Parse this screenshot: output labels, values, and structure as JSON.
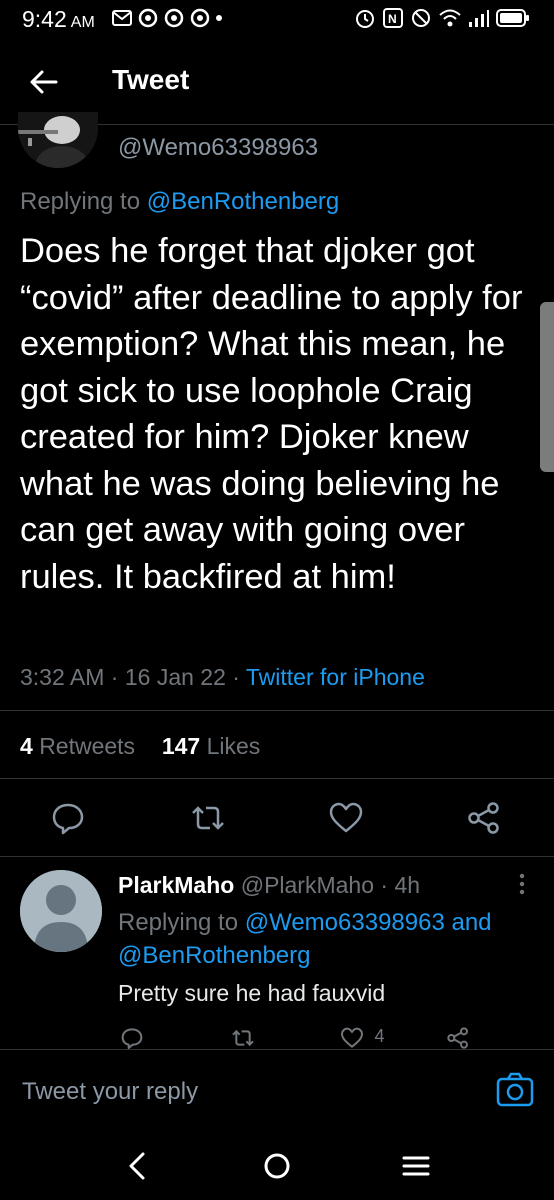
{
  "status_bar": {
    "time": "9:42",
    "ampm": "AM"
  },
  "header": {
    "title": "Tweet",
    "back_icon": "arrow-left-icon"
  },
  "main_tweet": {
    "handle": "@Wemo63398963",
    "replying_prefix": "Replying to",
    "replying_to": "@BenRothenberg",
    "text": "Does he forget that djoker got “covid” after deadline to apply for exemption? What this mean, he got sick to use loophole Craig created for him? Djoker knew what he was doing believing he can get away with going over rules. It backfired at him!",
    "time": "3:32 AM",
    "date": "16 Jan 22",
    "source": "Twitter for iPhone",
    "retweets_count": "4",
    "retweets_label": "Retweets",
    "likes_count": "147",
    "likes_label": "Likes",
    "accent_color": "#1d9bf0"
  },
  "reply_tweet": {
    "name": "PlarkMaho",
    "handle": "@PlarkMaho",
    "age": "4h",
    "replying_prefix": "Replying to",
    "replying_to_1": "@Wemo63398963",
    "and": "and",
    "replying_to_2": "@BenRothenberg",
    "text": "Pretty sure he had fauxvid",
    "likes": "4"
  },
  "reply_bar": {
    "placeholder": "Tweet your reply"
  }
}
